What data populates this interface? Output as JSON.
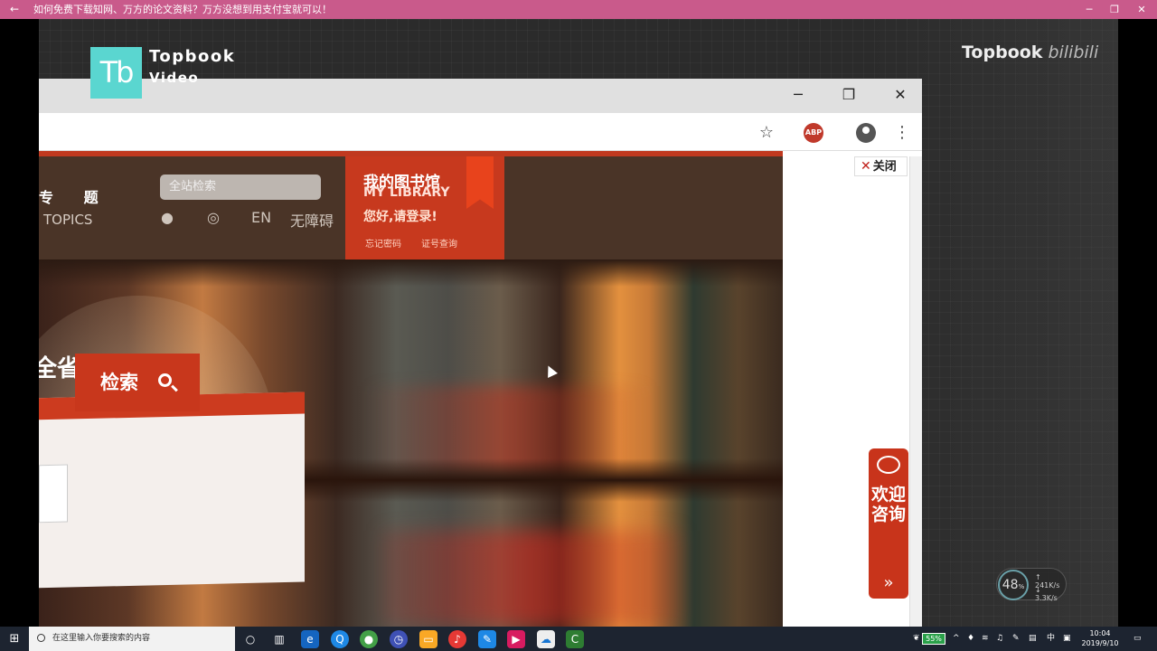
{
  "titlebar": {
    "title": "如何免费下载知网、万方的论文资料？万方没想到用支付宝就可以！",
    "back_icon": "←",
    "minimize_icon": "─",
    "restore_icon": "❐",
    "close_icon": "✕"
  },
  "video": {
    "logo_letters": "Tb",
    "brand_name": "Topbook",
    "brand_sub": "Video",
    "watermark": "Topbook",
    "watermark_sub": "bilibili"
  },
  "browser": {
    "minimize_icon": "─",
    "restore_icon": "❐",
    "close_icon": "✕",
    "bookmark_icon": "☆",
    "abp_label": "ABP",
    "menu_icon": "⋮"
  },
  "site": {
    "nav_zh": "专 题",
    "nav_en": "TOPICS",
    "search_placeholder": "全站检索",
    "lang_en": "EN",
    "accessible": "无障碍",
    "library": {
      "title_zh": "我的图书馆",
      "title_en": "MY LIBRARY",
      "login": "您好,请登录!",
      "forgot_password": "忘记密码",
      "card_query": "证号查询"
    },
    "hero_title": "全省书目",
    "search_button": "检索",
    "close_label": "关闭",
    "consult_label": "欢迎咨询",
    "consult_arrow": "»"
  },
  "speed_widget": {
    "percent": "48",
    "percent_unit": "%",
    "upload": "241",
    "upload_unit": "K/s",
    "download": "3.3",
    "download_unit": "K/s"
  },
  "taskbar": {
    "search_placeholder": "在这里输入你要搜索的内容",
    "battery": "55%",
    "ime": "中",
    "time": "10:04",
    "date": "2019/9/10"
  }
}
